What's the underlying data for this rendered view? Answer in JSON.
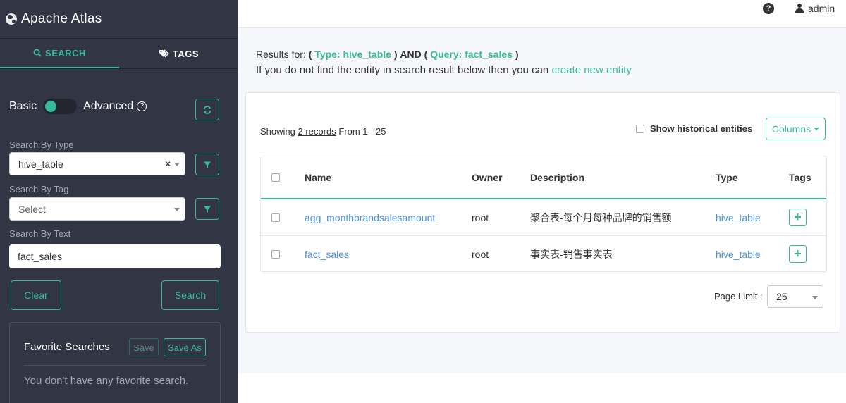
{
  "app": {
    "title": "Apache Atlas"
  },
  "sidebar": {
    "tabs": [
      {
        "label": "SEARCH",
        "icon": "search-icon"
      },
      {
        "label": "TAGS",
        "icon": "tag-icon"
      }
    ],
    "mode": {
      "basic_label": "Basic",
      "advanced_label": "Advanced"
    },
    "search_by_type": {
      "label": "Search By Type",
      "value": "hive_table",
      "clear": "×"
    },
    "search_by_tag": {
      "label": "Search By Tag",
      "placeholder": "Select"
    },
    "search_by_text": {
      "label": "Search By Text",
      "value": "fact_sales"
    },
    "clear_label": "Clear",
    "search_label": "Search",
    "favorites": {
      "title": "Favorite Searches",
      "save_label": "Save",
      "save_as_label": "Save As",
      "empty_text": "You don't have any favorite search."
    }
  },
  "header": {
    "help": "?",
    "user": "admin"
  },
  "main": {
    "results_prefix": "Results for:",
    "paren_open": "(",
    "paren_close": ")",
    "type_query": "Type: hive_table",
    "and_text": "AND",
    "text_query": "Query: fact_sales",
    "hint_text": "If you do not find the entity in search result below then you can",
    "create_link": "create new entity",
    "showing_prefix": "Showing",
    "records_link": "2 records",
    "showing_suffix": "From 1 - 25",
    "historical_label": "Show historical entities",
    "columns_label": "Columns",
    "table": {
      "headers": {
        "name": "Name",
        "owner": "Owner",
        "description": "Description",
        "type": "Type",
        "tags": "Tags"
      },
      "rows": [
        {
          "name": "agg_monthbrandsalesamount",
          "owner": "root",
          "description": "聚合表-每个月每种品牌的销售额",
          "type": "hive_table",
          "tag_add": "+"
        },
        {
          "name": "fact_sales",
          "owner": "root",
          "description": "事实表-销售事实表",
          "type": "hive_table",
          "tag_add": "+"
        }
      ]
    },
    "page_limit_label": "Page Limit :",
    "page_limit_value": "25"
  },
  "colors": {
    "accent": "#38bb9b",
    "sidebar_bg": "#323544",
    "link": "#4a90e2"
  }
}
